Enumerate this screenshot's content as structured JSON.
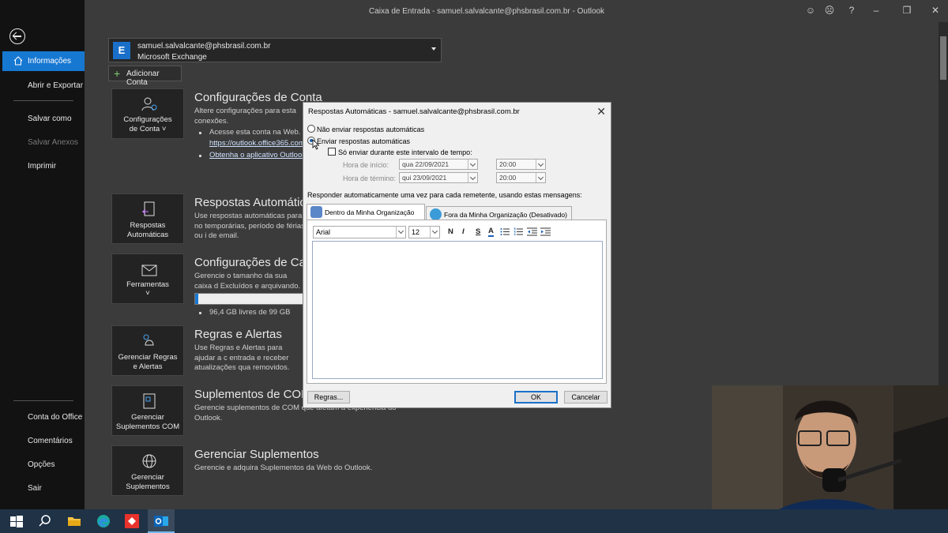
{
  "window": {
    "title": "Caixa de Entrada - samuel.salvalcante@phsbrasil.com.br  -  Outlook"
  },
  "nav": {
    "items": [
      "Informações",
      "Abrir e Exportar",
      "Salvar como",
      "Salvar Anexos",
      "Imprimir"
    ],
    "bottom_items": [
      "Conta do Office",
      "Comentários",
      "Opções",
      "Sair"
    ]
  },
  "account": {
    "email": "samuel.salvalcante@phsbrasil.com.br",
    "type": "Microsoft Exchange",
    "add_label": "Adicionar Conta"
  },
  "sections": {
    "account_settings": {
      "tile_label": "Configurações de Conta ˅",
      "title": "Configurações de Conta",
      "desc": "Altere configurações para esta conexões.",
      "bullet1": "Acesse esta conta na Web.",
      "link1": "https://outlook.office365.com",
      "link2": "Obtenha o aplicativo Outlook"
    },
    "auto_replies": {
      "tile_label": "Respostas Automáticas",
      "title": "Respostas Automática",
      "desc": "Use respostas automáticas para no temporárias, período de férias ou i de email."
    },
    "mailbox": {
      "tile_label": "Ferramentas",
      "title": "Configurações de Caix",
      "desc": "Gerencie o tamanho da sua caixa d Excluídos e arquivando.",
      "storage": "96,4 GB livres de 99 GB",
      "storage_used_fraction": 0.03
    },
    "rules": {
      "tile_label": "Gerenciar Regras e Alertas",
      "title": "Regras e Alertas",
      "desc": "Use Regras e Alertas para ajudar a c entrada e receber atualizações qua removidos."
    },
    "com_addins": {
      "tile_label": "Gerenciar Suplementos COM",
      "title": "Suplementos de COM",
      "desc": "Gerencie suplementos de COM que afetam a experiência do Outlook."
    },
    "addins": {
      "tile_label": "Gerenciar Suplementos",
      "title": "Gerenciar Suplementos",
      "desc": "Gerencie e adquira Suplementos da Web do Outlook."
    }
  },
  "dialog": {
    "title": "Respostas Automáticas - samuel.salvalcante@phsbrasil.com.br",
    "opt_no": "Não enviar respostas automáticas",
    "opt_yes": "Enviar respostas automáticas",
    "only_interval": "Só enviar durante este intervalo de tempo:",
    "start_label": "Hora de início:",
    "end_label": "Hora de término:",
    "start_date": "qua 22/09/2021",
    "start_time": "20:00",
    "end_date": "qui 23/09/2021",
    "end_time": "20:00",
    "reply_once": "Responder automaticamente uma vez para cada remetente, usando estas mensagens:",
    "tab_inside": "Dentro da Minha Organização",
    "tab_outside": "Fora da Minha Organização (Desativado)",
    "font": "Arial",
    "size": "12",
    "fmt_bold": "N",
    "fmt_italic": "I",
    "fmt_underline": "S",
    "fmt_color": "A",
    "btn_rules": "Regras...",
    "btn_ok": "OK",
    "btn_cancel": "Cancelar"
  },
  "icons": {
    "exchange": "exchange-icon",
    "exchange_letter": "E",
    "close": "close-icon"
  },
  "titlebar": {
    "help": "?",
    "close": "✕"
  }
}
